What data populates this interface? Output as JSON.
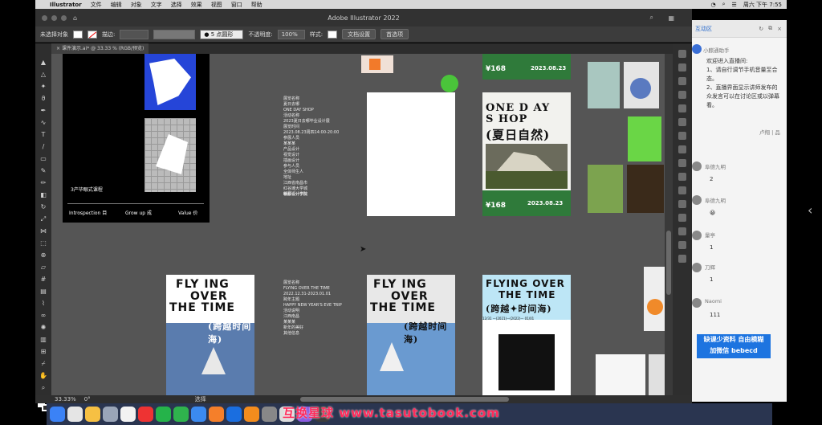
{
  "menubar": {
    "app": "Illustrator",
    "items": [
      "文件",
      "编辑",
      "对象",
      "文字",
      "选择",
      "效果",
      "视图",
      "窗口",
      "帮助"
    ],
    "clock": "周六 下午 7:55"
  },
  "window": {
    "title": "Adobe Illustrator 2022"
  },
  "controlbar": {
    "no_selection": "未选择对象",
    "stroke_label": "描边:",
    "brush": "5 点圆形",
    "opacity_label": "不透明度:",
    "opacity_value": "100%",
    "style_label": "样式:",
    "doc_setup": "文档设置",
    "prefs": "首选项"
  },
  "tab": {
    "label": "课件演示.ai* @ 33.33 % (RGB/预览)"
  },
  "status": {
    "zoom": "33.33%",
    "rotation": "0°",
    "mode": "选择"
  },
  "artboard_left": {
    "label": "3产毕眼式课程",
    "footer": [
      "Introspection 目",
      "Grow up 成",
      "Value 价"
    ]
  },
  "info_text_1": {
    "lines": [
      "展览名称",
      "夏日去哪",
      "ONE DAY SHOP",
      "活动名称",
      "2023夏日去哪毕业设计展",
      "展览时间",
      "2023.08.23周四14:00-20:00",
      "参展人员",
      "某某某",
      "产品设计",
      "视觉设计",
      "插画设计",
      "参与人员",
      "全体师生人",
      "地址",
      "江西省南昌市",
      "红谷滩大学城",
      "赣鄱设计学院"
    ]
  },
  "info_text_2": {
    "lines": [
      "展览名称",
      "FLYING OVER THE TIME",
      "2022.12.31-2023.01.01",
      "跨年主题",
      "HAPPY NEW YEAR'S EVE TRIP",
      "活动说明",
      "江西南昌",
      "某某某",
      "新年的美好",
      "其他信息"
    ]
  },
  "poster_summer": {
    "top_price": "¥168",
    "top_date": "2023.08.23",
    "title_line1": "ONE D AY",
    "title_line2": "S HOP",
    "title_cn": "(夏日自然)",
    "bottom_price": "¥168",
    "bottom_date": "2023.08.23"
  },
  "poster_fly_1": {
    "title1": "FLY ING",
    "title2": "OVER",
    "title3": "THE TIME",
    "cn": "(跨越时间海)"
  },
  "poster_fly_2": {
    "title1": "FLY ING",
    "title2": "OVER",
    "title3": "THE TIME",
    "cn": "(跨越时间海)"
  },
  "poster_fly_3": {
    "title1": "FLYING OVER",
    "title2": "THE TIME",
    "cn": "(跨越✦时间海)",
    "date": "12/31 —(2021)—(2022)— 01/01"
  },
  "chat": {
    "header": "互动区",
    "host": "小麒通助手",
    "welcome": "欢迎进入直播间:",
    "msg1": "1、请自行调节手机音量至合",
    "msg1b": "态。",
    "msg2": "2、直播界面显示讲师发布的",
    "msg2b": "众发言可以在讨论区或以弹幕",
    "msg2c": "看。",
    "teacher_tag": "卢翔 | 品",
    "messages": [
      {
        "name": "阜德九明",
        "text": "2"
      },
      {
        "name": "阜德九明",
        "text": "😀"
      },
      {
        "name": "量亭",
        "text": "1"
      },
      {
        "name": "刀辉",
        "text": "1"
      },
      {
        "name": "Naomi",
        "text": "111"
      }
    ],
    "ad_line1": "缺课少资料 自由模糊",
    "ad_line2": "加微信 bebecd"
  },
  "watermark": "互换星球 www.tasutobook.com",
  "colors": {
    "blue": "#2545d8",
    "green": "#4ac43a",
    "app_bg": "#535353"
  }
}
